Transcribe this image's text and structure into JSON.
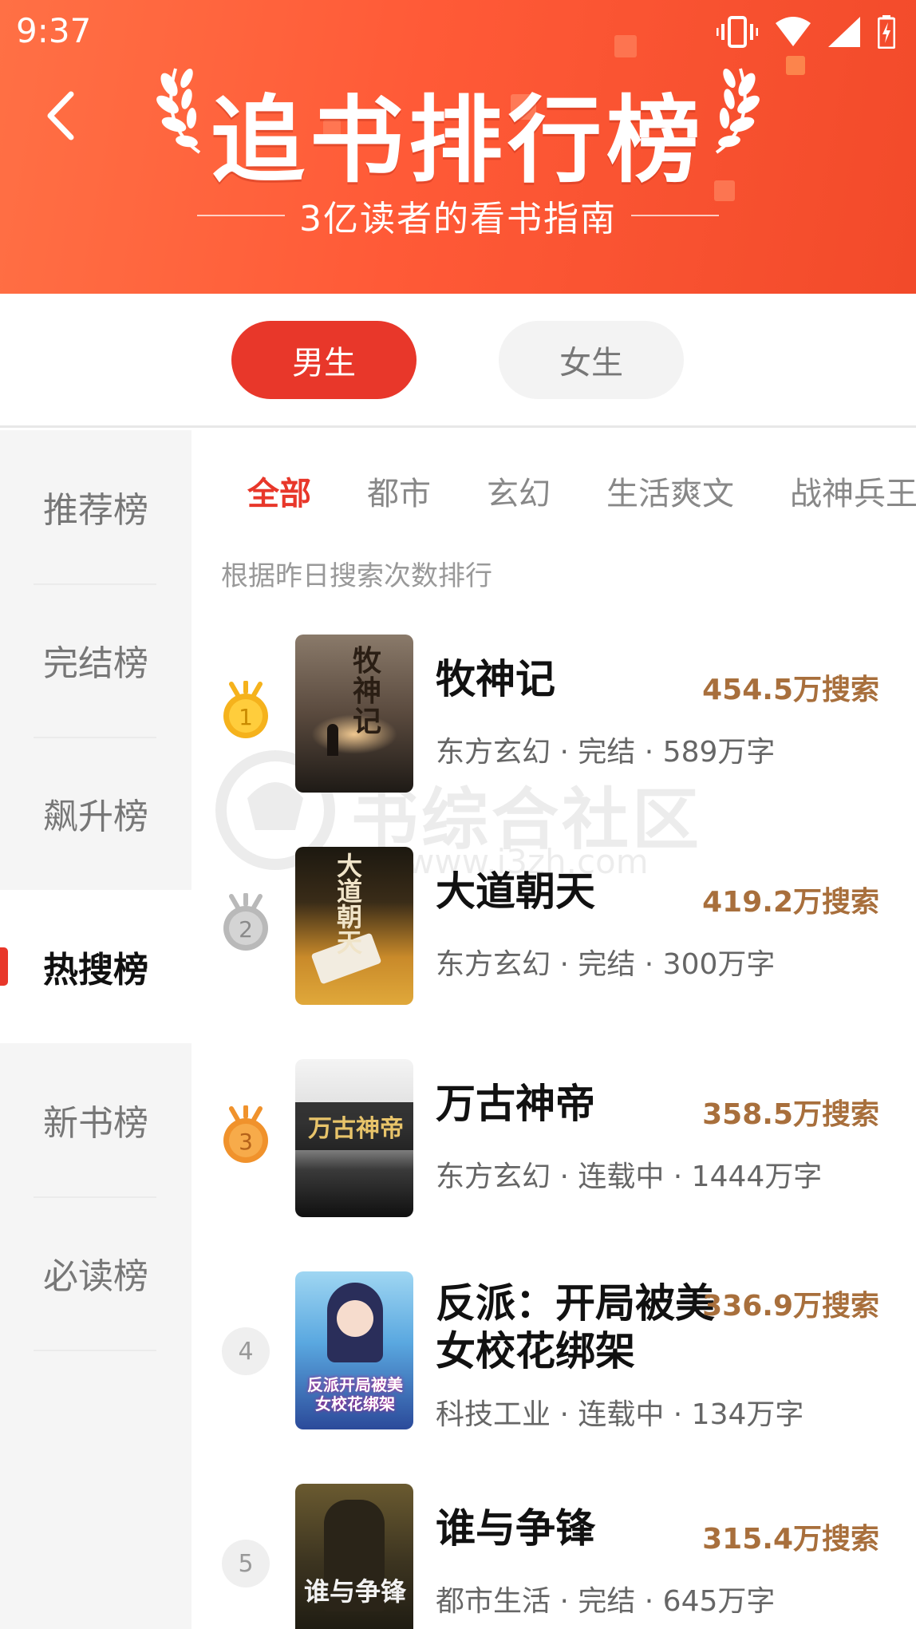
{
  "status_bar": {
    "time": "9:37"
  },
  "header": {
    "title": "追书排行榜",
    "subtitle": "3亿读者的看书指南",
    "accent": "#ff5a37"
  },
  "gender_tabs": [
    {
      "label": "男生",
      "active": true
    },
    {
      "label": "女生",
      "active": false
    }
  ],
  "sidebar": {
    "items": [
      {
        "label": "推荐榜",
        "active": false
      },
      {
        "label": "完结榜",
        "active": false
      },
      {
        "label": "飙升榜",
        "active": false
      },
      {
        "label": "热搜榜",
        "active": true
      },
      {
        "label": "新书榜",
        "active": false
      },
      {
        "label": "必读榜",
        "active": false
      }
    ]
  },
  "categories": {
    "tabs": [
      {
        "label": "全部",
        "active": true
      },
      {
        "label": "都市",
        "active": false
      },
      {
        "label": "玄幻",
        "active": false
      },
      {
        "label": "生活爽文",
        "active": false
      },
      {
        "label": "战神兵王",
        "active": false
      }
    ],
    "hint": "根据昨日搜索次数排行"
  },
  "books": [
    {
      "rank": "1",
      "title": "牧神记",
      "count": "454.5万搜索",
      "meta": "东方玄幻 · 完结 · 589万字",
      "cover_text": "牧神记"
    },
    {
      "rank": "2",
      "title": "大道朝天",
      "count": "419.2万搜索",
      "meta": "东方玄幻 · 完结 · 300万字",
      "cover_text": "大道朝天"
    },
    {
      "rank": "3",
      "title": "万古神帝",
      "count": "358.5万搜索",
      "meta": "东方玄幻 · 连载中 · 1444万字",
      "cover_text": "万古神帝"
    },
    {
      "rank": "4",
      "title": "反派：开局被美女校花绑架",
      "count": "336.9万搜索",
      "meta": "科技工业 · 连载中 · 134万字",
      "cover_text": "反派开局被美女校花绑架"
    },
    {
      "rank": "5",
      "title": "谁与争锋",
      "count": "315.4万搜索",
      "meta": "都市生活 · 完结 · 645万字",
      "cover_text": "谁与争锋"
    }
  ],
  "watermark": {
    "text": "书综合社区",
    "url": "www.i3zh.com"
  },
  "colors": {
    "brand_red": "#e8372a",
    "count_brown": "#a86f3c",
    "gold": "#f5b21c",
    "silver": "#b9b9b9",
    "bronze": "#f0922c"
  }
}
